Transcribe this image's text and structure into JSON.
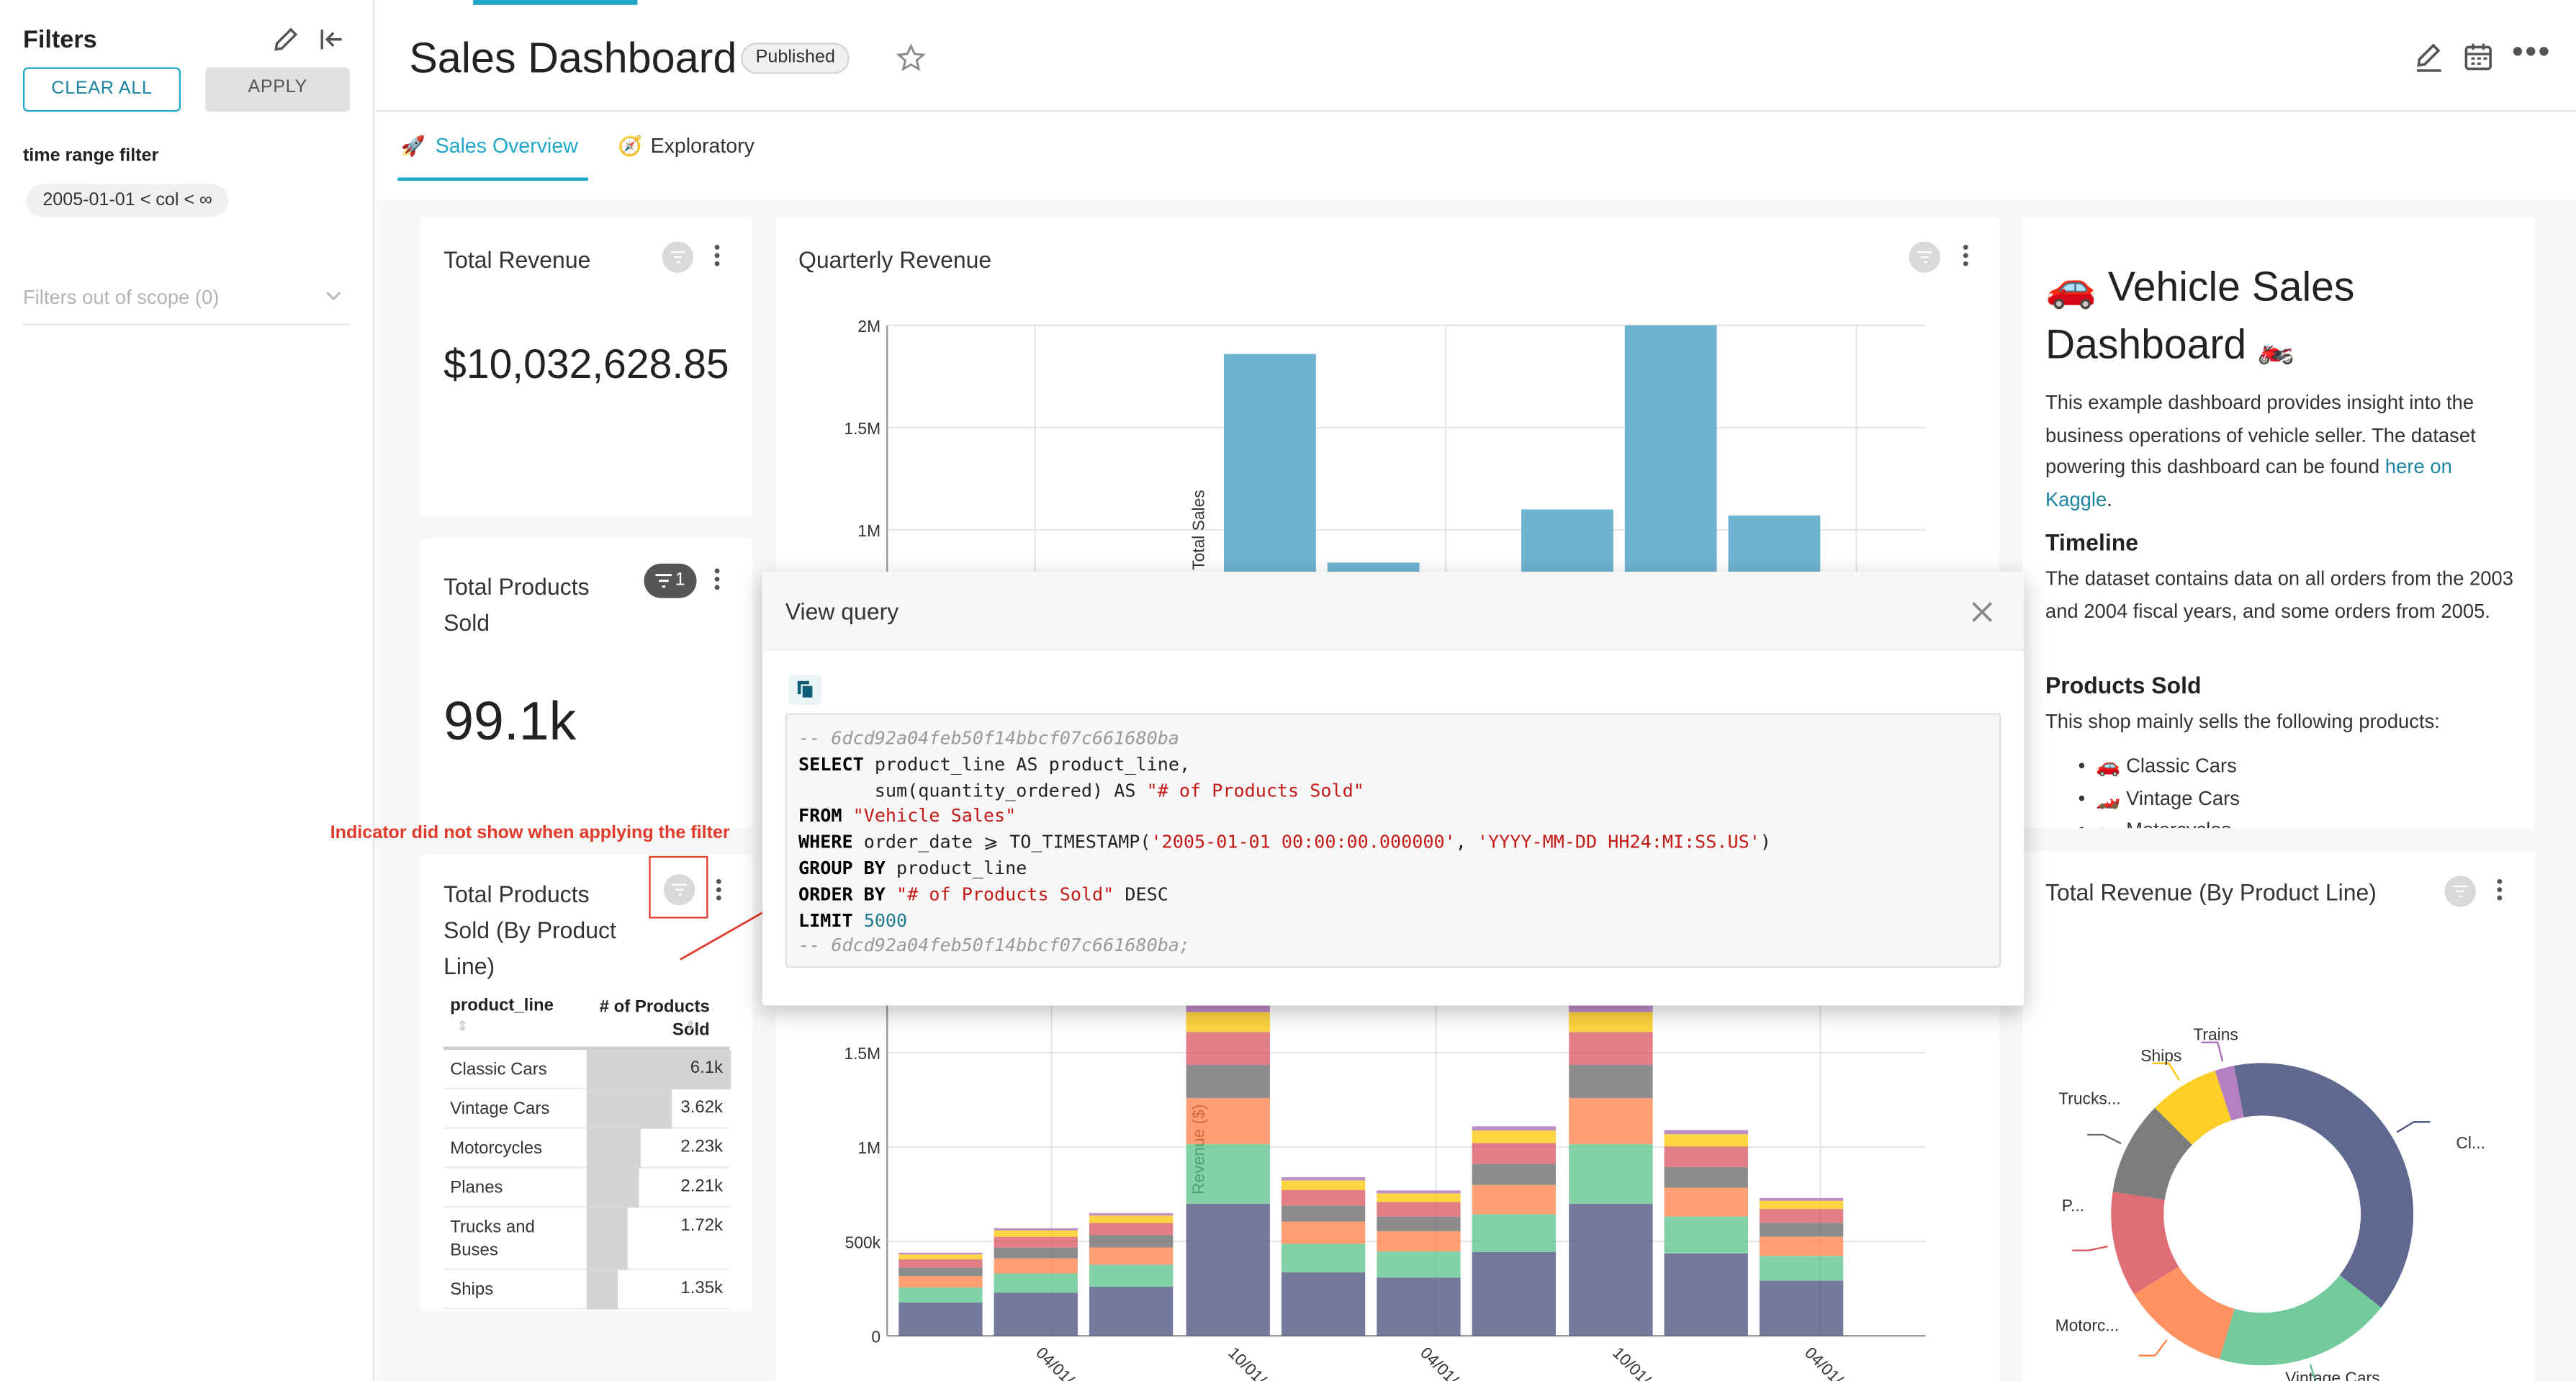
{
  "sidebar": {
    "title": "Filters",
    "clear_all": "CLEAR ALL",
    "apply": "APPLY",
    "filter_label": "time range filter",
    "filter_value": "2005-01-01 < col < ∞",
    "out_of_scope": "Filters out of scope (0)"
  },
  "header": {
    "title": "Sales Dashboard",
    "status_badge": "Published"
  },
  "tabs": [
    {
      "label": "Sales Overview",
      "active": true
    },
    {
      "label": "Exploratory",
      "active": false
    }
  ],
  "cards": {
    "total_revenue": {
      "title": "Total Revenue",
      "value": "$10,032,628.85"
    },
    "total_products": {
      "title_line1": "Total Products",
      "title_line2": "Sold",
      "value": "99.1k",
      "filter_badge": "1"
    },
    "by_product_line": {
      "title_line1": "Total Products",
      "title_line2": "Sold (By Product",
      "title_line3": "Line)",
      "col1": "product_line",
      "col2_line1": "# of Products",
      "col2_line2": "Sold",
      "rows": [
        {
          "label": "Classic Cars",
          "value": "6.1k",
          "ratio": 1.0
        },
        {
          "label": "Vintage Cars",
          "value": "3.62k",
          "ratio": 0.59
        },
        {
          "label": "Motorcycles",
          "value": "2.23k",
          "ratio": 0.37
        },
        {
          "label": "Planes",
          "value": "2.21k",
          "ratio": 0.36
        },
        {
          "label": "Trucks and",
          "label2": "Buses",
          "value": "1.72k",
          "ratio": 0.28
        },
        {
          "label": "Ships",
          "value": "1.35k",
          "ratio": 0.22
        }
      ]
    },
    "quarterly_revenue": {
      "title": "Quarterly Revenue"
    },
    "vehicle_sales": {
      "title_line1": "Vehicle Sales",
      "title_line2": "Dashboard",
      "intro": "This example dashboard provides insight into the business operations of vehicle seller. The dataset powering this dashboard can be found",
      "link": "here on Kaggle",
      "timeline_heading": "Timeline",
      "timeline_text": "The dataset contains data on all orders from the 2003 and 2004 fiscal years, and some orders from 2005.",
      "products_heading": "Products Sold",
      "products_text": "This shop mainly sells the following products:",
      "products": [
        "Classic Cars",
        "Vintage Cars",
        "Motorcycles"
      ]
    },
    "revenue_by_line": {
      "title": "Total Revenue (By Product Line)"
    }
  },
  "annotation": {
    "text": "Indicator did not show when applying the filter"
  },
  "modal": {
    "title": "View query",
    "hash_comment": "-- 6dcd92a04feb50f14bbcf07c661680ba",
    "hash_comment_end": "-- 6dcd92a04feb50f14bbcf07c661680ba;",
    "kw_select": "SELECT",
    "sel_1": " product_line AS product_line,",
    "sel_2": "       sum(quantity_ordered) AS ",
    "str_alias": "\"# of Products Sold\"",
    "kw_from": "FROM",
    "str_table": "\"Vehicle Sales\"",
    "kw_where": "WHERE",
    "where_1": " order_date ⩾ TO_TIMESTAMP(",
    "str_ts": "'2005-01-01 00:00:00.000000'",
    "comma": ", ",
    "str_fmt": "'YYYY-MM-DD HH24:MI:SS.US'",
    "close_paren": ")",
    "kw_group": "GROUP BY",
    "group_1": " product_line",
    "kw_order": "ORDER BY",
    "order_desc": " DESC",
    "kw_limit": "LIMIT",
    "num_limit": "5000"
  },
  "chart_data": [
    {
      "type": "bar",
      "title": "Quarterly Revenue",
      "ylabel": "Total Sales",
      "y_ticks": [
        "2M",
        "1.5M",
        "1M"
      ],
      "values": [
        null,
        1.86,
        0.84,
        null,
        1.1,
        2.0,
        1.07,
        null
      ],
      "ylim": [
        0,
        2.0
      ]
    },
    {
      "type": "bar",
      "stacked": true,
      "ylabel": "Revenue ($)",
      "y_ticks": [
        "1.5M",
        "1M",
        "500k",
        "0"
      ],
      "x_ticks": [
        "04/01/",
        "10/01/",
        "04/01/",
        "10/01/",
        "04/01/"
      ],
      "totals": [
        0.44,
        0.57,
        0.65,
        1.75,
        0.84,
        0.77,
        1.11,
        1.75,
        1.09,
        0.73
      ],
      "ylim": [
        0,
        1.75
      ]
    },
    {
      "type": "pie",
      "title": "Total Revenue (By Product Line)",
      "labels": [
        "Cl...",
        "Vintage Cars",
        "Motorc...",
        "P...",
        "Trucks...",
        "Ships",
        "Trains"
      ],
      "values": [
        39.1,
        19.2,
        11.7,
        11.4,
        10.2,
        7.6,
        2.1
      ],
      "colors": [
        "#454e7c",
        "#5ac189",
        "#ff7f44",
        "#d8545d",
        "#666666",
        "#fcc700",
        "#a868b7"
      ]
    }
  ]
}
